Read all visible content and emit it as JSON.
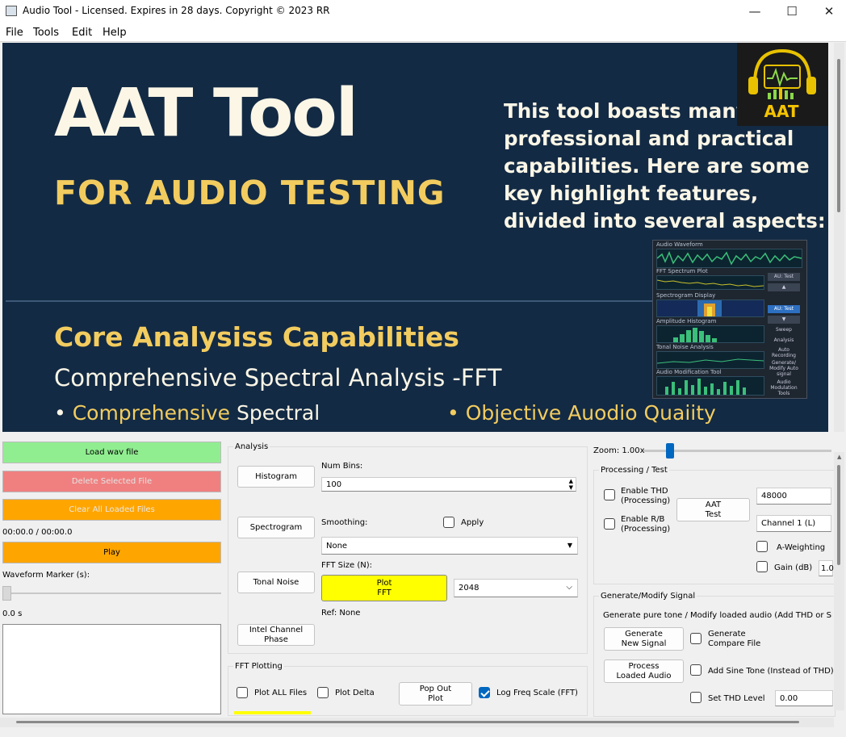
{
  "window": {
    "title": "Audio Tool - Licensed. Expires in 28 days.   Copyright © 2023 RR",
    "controls": [
      "—",
      "☐",
      "✕"
    ]
  },
  "menu": [
    "File",
    "Tools",
    "Edit",
    "Help"
  ],
  "banner": {
    "title": "AAT Tool",
    "subtitle": "FOR AUDIO TESTING",
    "intro": "This tool boasts many professional and practical capabilities. Here are some key highlight features, divided into several aspects:",
    "logo_text": "AAT",
    "core_heading": "Core Analysiss Capabilities",
    "section_heading": "Comprehensive Spectral Analysis -FFT",
    "bullet1_a": "Comprehensive",
    "bullet1_b": " Spectral",
    "bullet2": "Objective Auodio Quaiity",
    "thumb": {
      "labels": [
        "Audio Waveform",
        "FFT Spectrum Plot",
        "Spectrogram Display",
        "Amplitude Histogram",
        "Tonal Noise Analysis",
        "Audio Modification Tool"
      ],
      "buttons": [
        "AU: Test",
        "▲",
        "AU: Test",
        "▼",
        "Sweep",
        "Analysis",
        "Auto Recording",
        "Generate/ Modify Auto signal",
        "Audio Modulation Tools"
      ]
    }
  },
  "left": {
    "load": "Load wav file",
    "delete": "Delete Selected File",
    "clear": "Clear All Loaded Files",
    "time": "00:00.0 / 00:00.0",
    "play": "Play",
    "marker_label": "Waveform Marker (s):",
    "marker_value": "0.0 s",
    "marker_level": 0
  },
  "analysis": {
    "title": "Analysis",
    "histogram": "Histogram",
    "spectrogram": "Spectrogram",
    "tonal": "Tonal Noise",
    "phase": "Intel Channel Phase",
    "bins_label": "Num Bins:",
    "bins_value": "100",
    "smoothing_label": "Smoothing:",
    "apply": "Apply",
    "smoothing_value": "None",
    "fft_label": "FFT Size (N):",
    "plot_fft": "Plot\nFFT",
    "fft_value": "2048",
    "ref": "Ref: None"
  },
  "fftplot": {
    "title": "FFT Plotting",
    "plot_all": "Plot ALL Files",
    "plot_delta": "Plot Delta",
    "popout": "Pop Out\nPlot",
    "log_freq": "Log Freq Scale (FFT)",
    "log_checked": true
  },
  "right": {
    "zoom": "Zoom: 1.00x",
    "processing_title": "Processing / Test",
    "thd": "Enable THD\n(Processing)",
    "rb": "Enable R/B\n(Processing)",
    "aat_test": "AAT\nTest",
    "rate": "48000",
    "channel": "Channel 1 (L)",
    "aweight": "A-Weighting",
    "gain": "Gain (dB)",
    "gain_value": "1.0",
    "gen_title": "Generate/Modify Signal",
    "gen_desc": "Generate pure tone / Modify loaded audio (Add THD or Sine to",
    "gen_new": "Generate\nNew Signal",
    "gen_compare": "Generate\nCompare File",
    "process": "Process\nLoaded Audio",
    "sine": "Add Sine Tone (Instead of THD)",
    "set_thd": "Set THD Level",
    "thd_value": "0.00"
  },
  "colors": {
    "banner_bg": "#132a44",
    "gold": "#f2cc5f",
    "green": "#90ee90",
    "red": "#f08080",
    "orange": "#ffa500",
    "yellow": "#ffff00"
  }
}
